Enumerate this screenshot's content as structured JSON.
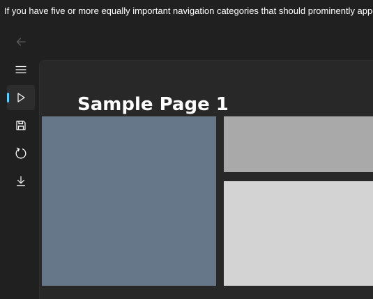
{
  "description": "If you have five or more equally important navigation categories that should prominently appear on larger window widths, consider using top navigation.",
  "nav": {
    "items": [
      {
        "icon": "back-arrow-icon",
        "selected": false
      },
      {
        "icon": "hamburger-menu-icon",
        "selected": false
      },
      {
        "icon": "play-icon",
        "selected": true
      },
      {
        "icon": "save-icon",
        "selected": false
      },
      {
        "icon": "refresh-icon",
        "selected": false
      },
      {
        "icon": "download-icon",
        "selected": false
      }
    ],
    "selection_accent": "#60cdff"
  },
  "page": {
    "title": "Sample Page 1"
  },
  "colors": {
    "large_rect": "#67778a",
    "top_rect": "#a9a9a9",
    "bottom_rect": "#d3d3d3"
  }
}
